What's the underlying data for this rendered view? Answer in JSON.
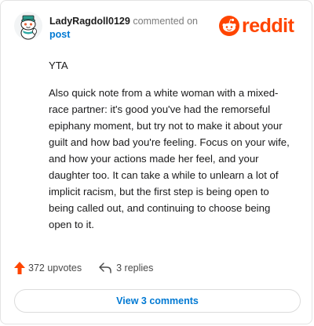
{
  "comment": {
    "username": "LadyRagdoll0129",
    "action_text": "commented on",
    "target_text": "post",
    "paragraphs": [
      "YTA",
      "Also quick note from a white woman with a mixed-race partner: it's good you've had the remorseful epiphany moment, but try not to make it about your guilt and how bad you're feeling. Focus on your wife, and how your actions made her feel, and your daughter too. It can take a while to unlearn a lot of implicit racism, but the first step is being open to being called out, and continuing to choose being open to it."
    ],
    "upvotes": "372 upvotes",
    "replies": "3 replies",
    "view_comments_label": "View 3 comments"
  },
  "brand": {
    "wordmark": "reddit",
    "color": "#ff4500"
  },
  "colors": {
    "link": "#0079d3",
    "upvote": "#ff4500"
  },
  "icons": {
    "avatar": "snoo-avatar",
    "upvote": "upvote-arrow-icon",
    "reply": "reply-arrow-icon",
    "logo": "reddit-snoo-icon"
  }
}
